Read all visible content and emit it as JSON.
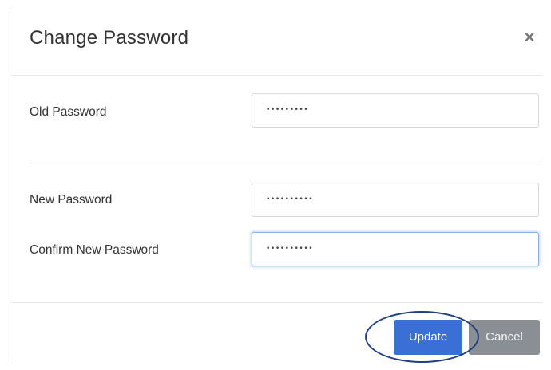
{
  "dialog": {
    "title": "Change Password",
    "close_label": "×"
  },
  "form": {
    "old_password": {
      "label": "Old Password",
      "value": "•••••••••"
    },
    "new_password": {
      "label": "New Password",
      "value": "••••••••••"
    },
    "confirm_password": {
      "label": "Confirm New Password",
      "value": "••••••••••",
      "focused": true
    }
  },
  "footer": {
    "update_label": "Update",
    "cancel_label": "Cancel"
  },
  "colors": {
    "primary": "#3a6fd6",
    "secondary": "#8a8f96",
    "annotation": "#1f3f7d"
  }
}
